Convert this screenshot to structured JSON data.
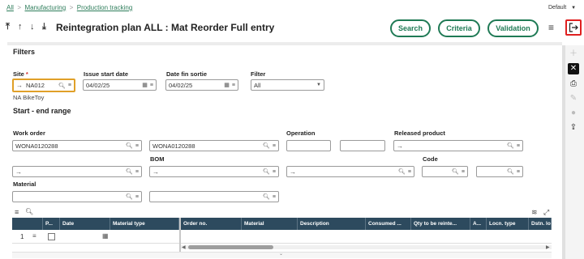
{
  "breadcrumb": {
    "items": [
      "All",
      "Manufacturing",
      "Production tracking"
    ]
  },
  "profile": {
    "label": "Default"
  },
  "header": {
    "title": "Reintegration plan ALL : Mat Reorder Full entry"
  },
  "actions": {
    "search": "Search",
    "criteria": "Criteria",
    "validation": "Validation"
  },
  "filters": {
    "section_title": "Filters",
    "site": {
      "label": "Site",
      "value": "NA012",
      "description": "NA BikeToy"
    },
    "issue_start": {
      "label": "Issue start date",
      "value": "04/02/25"
    },
    "issue_end": {
      "label": "Date fin sortie",
      "value": "04/02/25"
    },
    "filter": {
      "label": "Filter",
      "value": "All"
    }
  },
  "range": {
    "section_title": "Start - end range",
    "work_order": {
      "label": "Work order",
      "from": "WONA0120288",
      "to": "WONA0120288"
    },
    "operation": {
      "label": "Operation"
    },
    "released_product": {
      "label": "Released product"
    },
    "bom": {
      "label": "BOM"
    },
    "code": {
      "label": "Code"
    },
    "material": {
      "label": "Material"
    }
  },
  "grid": {
    "columns_left": [
      "P...",
      "Date",
      "Material type"
    ],
    "columns_right": [
      "Order no.",
      "Material",
      "Description",
      "Consumed ...",
      "Qty to be reinte...",
      "A...",
      "Locn. type",
      "Dstn. lo"
    ],
    "rows": [
      {
        "num": "1"
      }
    ]
  }
}
